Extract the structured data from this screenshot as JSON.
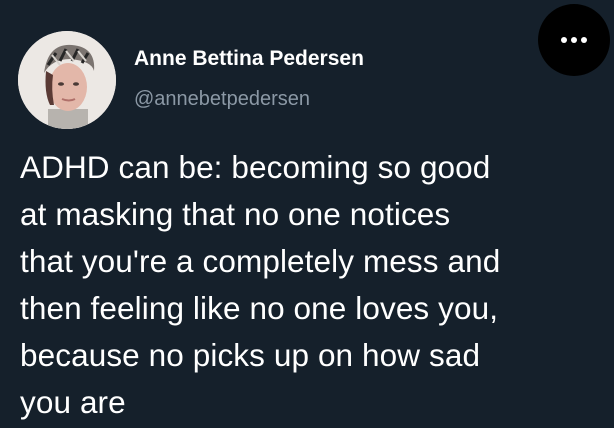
{
  "author": {
    "display_name": "Anne Bettina Pedersen",
    "handle": "@annebetpedersen",
    "avatar_icon": "profile-photo"
  },
  "menu": {
    "more_icon": "more-horizontal-icon"
  },
  "tweet": {
    "lines": [
      "ADHD can be: becoming so good",
      "at masking that no one notices",
      "that you're a completely mess and",
      "then feeling like no one loves you,",
      "because no picks up on how sad",
      "you are"
    ]
  },
  "colors": {
    "background": "#15202b",
    "text": "#ffffff",
    "secondary_text": "#8b98a5",
    "more_button_bg": "#000000"
  }
}
